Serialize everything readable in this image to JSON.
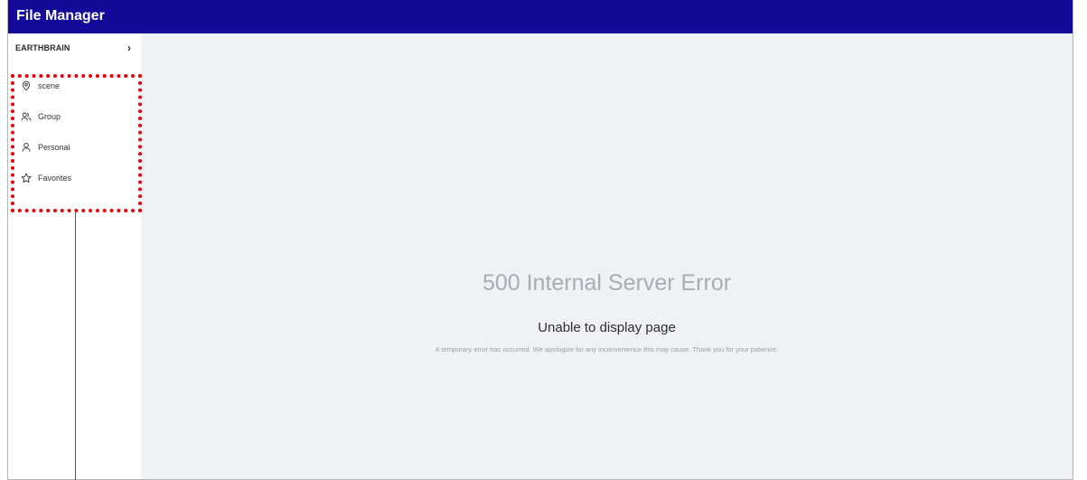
{
  "app": {
    "title": "File Manager",
    "brand_color": "#140a99"
  },
  "sidebar": {
    "header_label": "EARTHBRAIN",
    "items": [
      {
        "label": "scene",
        "icon": "location-pin-icon"
      },
      {
        "label": "Group",
        "icon": "group-icon"
      },
      {
        "label": "Personal",
        "icon": "person-icon"
      },
      {
        "label": "Favorites",
        "icon": "star-icon"
      }
    ]
  },
  "error": {
    "code_text": "500 Internal Server Error",
    "title": "Unable to display page",
    "message": "A temporary error has occurred. We apologize for any inconvenience this may cause. Thank you for your patience."
  },
  "annotation": {
    "color": "#e8000b"
  }
}
